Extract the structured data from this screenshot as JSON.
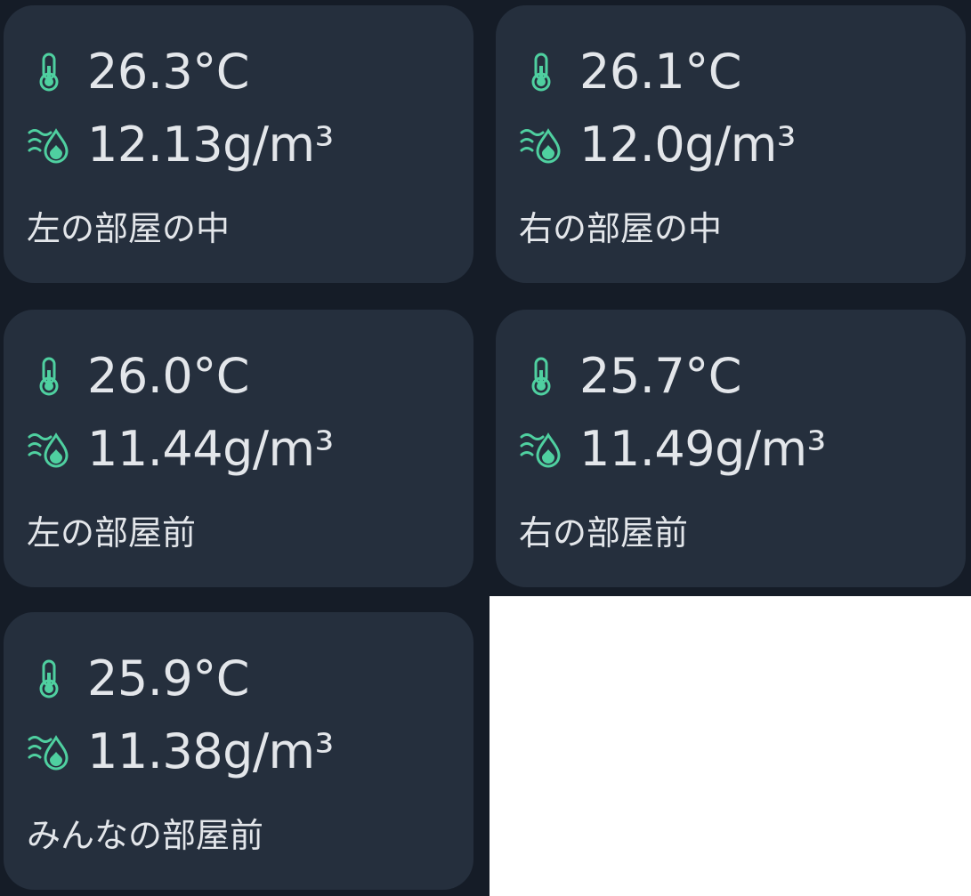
{
  "theme": {
    "background": "#151c27",
    "card": "#252f3d",
    "accent": "#4fd0a0",
    "text": "#e3e6ea"
  },
  "cards": [
    {
      "temperature": "26.3°C",
      "humidity": "12.13g/m³",
      "name": "左の部屋の中",
      "temp_icon": "thermometer-icon",
      "hum_icon": "humidity-icon"
    },
    {
      "temperature": "26.1°C",
      "humidity": "12.0g/m³",
      "name": "右の部屋の中",
      "temp_icon": "thermometer-icon",
      "hum_icon": "humidity-icon"
    },
    {
      "temperature": "26.0°C",
      "humidity": "11.44g/m³",
      "name": "左の部屋前",
      "temp_icon": "thermometer-icon",
      "hum_icon": "humidity-icon"
    },
    {
      "temperature": "25.7°C",
      "humidity": "11.49g/m³",
      "name": "右の部屋前",
      "temp_icon": "thermometer-icon",
      "hum_icon": "humidity-icon"
    },
    {
      "temperature": "25.9°C",
      "humidity": "11.38g/m³",
      "name": "みんなの部屋前",
      "temp_icon": "thermometer-icon",
      "hum_icon": "humidity-icon"
    }
  ]
}
